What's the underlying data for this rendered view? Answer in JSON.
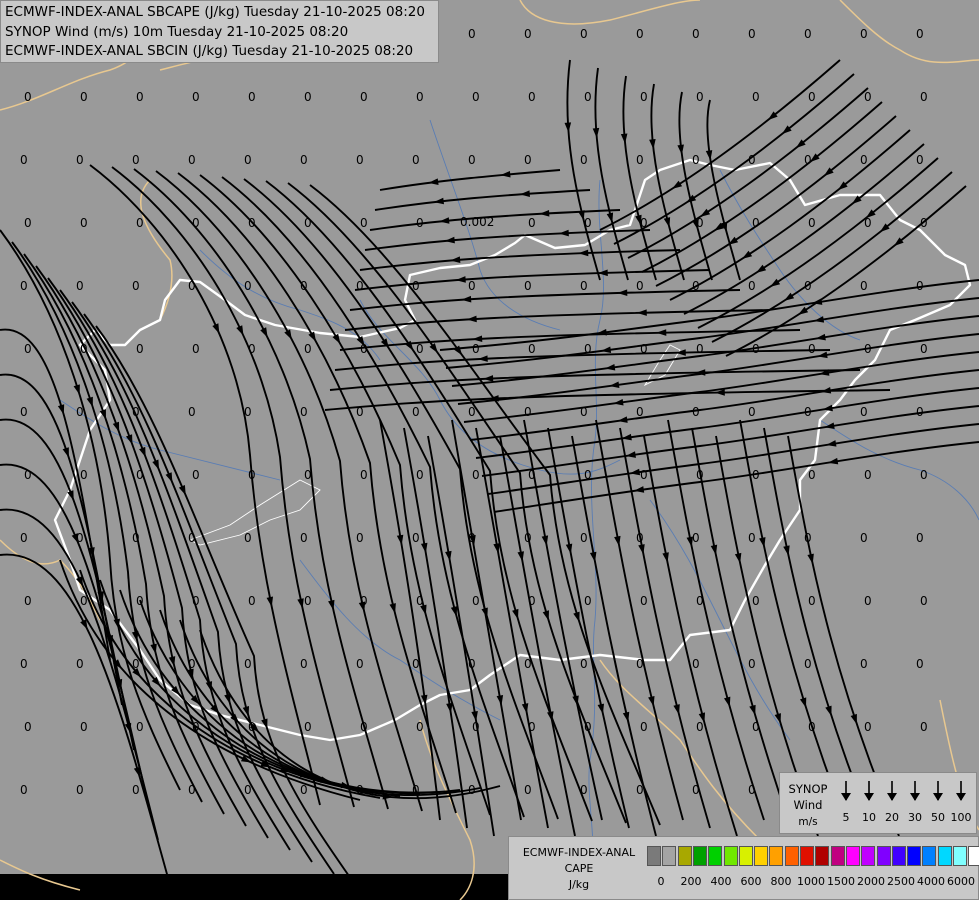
{
  "titles": {
    "line1": "ECMWF-INDEX-ANAL SBCAPE (J/kg) Tuesday 21-10-2025 08:20",
    "line2": "SYNOP Wind (m/s) 10m Tuesday 21-10-2025 08:20",
    "line3": "ECMWF-INDEX-ANAL SBCIN (J/kg) Tuesday 21-10-2025 08:20"
  },
  "colors": {
    "background": "#9a9a9a",
    "country_border": "#ffffff",
    "neighbour_border": "#e8c890",
    "rivers": "#4f78b8",
    "streamlines": "#000000"
  },
  "synop_legend": {
    "line1": "SYNOP",
    "line2": "Wind",
    "line3": "m/s",
    "speeds": [
      "5",
      "10",
      "20",
      "30",
      "50",
      "100"
    ]
  },
  "cape_legend": {
    "line1": "ECMWF-INDEX-ANAL",
    "line2": "CAPE",
    "line3": "J/kg",
    "ticks": [
      "0",
      "200",
      "400",
      "600",
      "800",
      "1000",
      "1500",
      "2000",
      "2500",
      "4000",
      "6000"
    ],
    "colors": [
      "#7a7a7a",
      "#a4a4a4",
      "#a8a800",
      "#00a000",
      "#00d000",
      "#70e800",
      "#d8f000",
      "#ffd000",
      "#ffa000",
      "#ff6000",
      "#e01000",
      "#b00000",
      "#c00080",
      "#ff00ff",
      "#c000ff",
      "#8000ff",
      "#4000ff",
      "#0000ff",
      "#0080ff",
      "#00d8ff",
      "#80ffff",
      "#ffffff"
    ]
  },
  "field_labels": {
    "cin_special": "0.002",
    "value": "0"
  }
}
